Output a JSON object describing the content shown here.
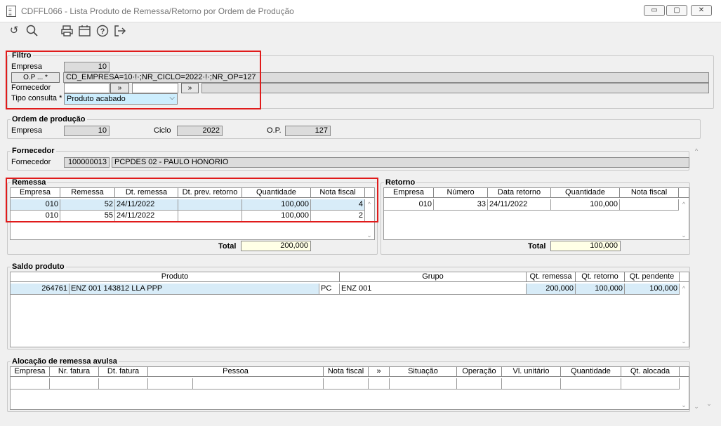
{
  "window": {
    "title": "CDFFL066 - Lista Produto de Remessa/Retorno por Ordem de Produção",
    "min": "▭",
    "max": "▢",
    "close": "✕"
  },
  "toolbar": {
    "icons": [
      "undo-icon",
      "search-icon",
      "print-icon",
      "calendar-icon",
      "help-icon",
      "exit-icon"
    ]
  },
  "filtro": {
    "title": "Filtro",
    "empresa_label": "Empresa",
    "empresa_value": "10",
    "op_button": "O.P ... *",
    "op_value": "CD_EMPRESA=10·!·;NR_CICLO=2022·!·;NR_OP=127",
    "fornecedor_label": "Fornecedor",
    "lookup_btn": "»",
    "tipo_label": "Tipo consulta *",
    "tipo_value": "Produto acabado"
  },
  "ordem": {
    "title": "Ordem de produção",
    "empresa_label": "Empresa",
    "empresa_value": "10",
    "ciclo_label": "Ciclo",
    "ciclo_value": "2022",
    "op_label": "O.P.",
    "op_value": "127"
  },
  "fornecedor": {
    "title": "Fornecedor",
    "label": "Fornecedor",
    "code": "100000013",
    "name": "PCPDES 02 - PAULO HONORIO"
  },
  "remessa": {
    "title": "Remessa",
    "headers": [
      "Empresa",
      "Remessa",
      "Dt. remessa",
      "Dt. prev. retorno",
      "Quantidade",
      "Nota fiscal"
    ],
    "rows": [
      {
        "empresa": "010",
        "remessa": "52",
        "dt": "24/11/2022",
        "prev": "",
        "qtd": "100,000",
        "nf": "4"
      },
      {
        "empresa": "010",
        "remessa": "55",
        "dt": "24/11/2022",
        "prev": "",
        "qtd": "100,000",
        "nf": "2"
      }
    ],
    "total_label": "Total",
    "total_value": "200,000"
  },
  "retorno": {
    "title": "Retorno",
    "headers": [
      "Empresa",
      "Número",
      "Data retorno",
      "Quantidade",
      "Nota fiscal"
    ],
    "rows": [
      {
        "empresa": "010",
        "numero": "33",
        "data": "24/11/2022",
        "qtd": "100,000",
        "nf": ""
      }
    ],
    "total_label": "Total",
    "total_value": "100,000"
  },
  "saldo": {
    "title": "Saldo produto",
    "headers": [
      "Produto",
      "Grupo",
      "Qt. remessa",
      "Qt. retorno",
      "Qt. pendente"
    ],
    "rows": [
      {
        "codigo": "264761",
        "produto": "ENZ 001 143812 LLA PPP",
        "tipo": "PC",
        "grupo": "ENZ 001",
        "qt_remessa": "200,000",
        "qt_retorno": "100,000",
        "qt_pendente": "100,000"
      }
    ]
  },
  "alocacao": {
    "title": "Alocação de remessa avulsa",
    "headers": [
      "Empresa",
      "Nr. fatura",
      "Dt. fatura",
      "Pessoa",
      "Nota fiscal",
      "»",
      "Situação",
      "Operação",
      "Vl. unitário",
      "Quantidade",
      "Qt. alocada"
    ]
  }
}
